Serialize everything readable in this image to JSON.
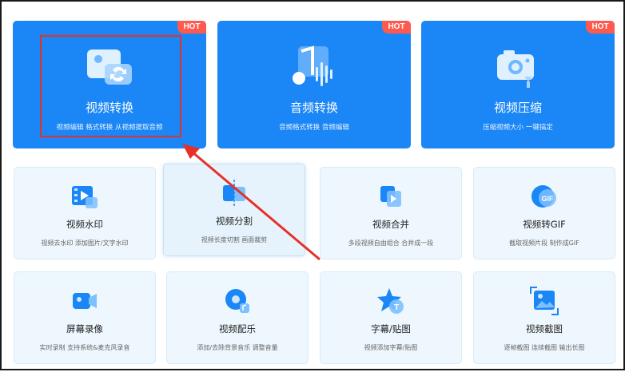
{
  "top_cards": [
    {
      "badge": "HOT",
      "title": "视频转换",
      "desc": "视频编辑 格式转换 从视频提取音频",
      "icon": "video-convert-icon"
    },
    {
      "badge": "HOT",
      "title": "音频转换",
      "desc": "音频格式转换 音频编辑",
      "icon": "audio-convert-icon"
    },
    {
      "badge": "HOT",
      "title": "视频压缩",
      "desc": "压缩视频大小 一键搞定",
      "icon": "video-compress-icon"
    }
  ],
  "tools_row1": [
    {
      "title": "视频水印",
      "desc": "视频去水印 添加图片/文字水印",
      "icon": "video-watermark-icon"
    },
    {
      "title": "视频分割",
      "desc": "视频长度切割 画面裁剪",
      "icon": "video-split-icon"
    },
    {
      "title": "视频合并",
      "desc": "多段视频自由组合 合并成一段",
      "icon": "video-merge-icon"
    },
    {
      "title": "视频转GIF",
      "desc": "截取视频片段 制作成GIF",
      "icon": "gif-icon",
      "icon_text": "GIF"
    }
  ],
  "tools_row2": [
    {
      "title": "屏幕录像",
      "desc": "实时录制 支持系统&麦克风录音",
      "icon": "screen-record-icon"
    },
    {
      "title": "视频配乐",
      "desc": "添加/去除背景音乐 调整音量",
      "icon": "video-music-icon"
    },
    {
      "title": "字幕/贴图",
      "desc": "视频添加字幕/贴图",
      "icon": "subtitle-sticker-icon",
      "icon_text": "T"
    },
    {
      "title": "视频截图",
      "desc": "逐帧截图 连续截图 输出长图",
      "icon": "video-screenshot-icon"
    }
  ],
  "colors": {
    "primary": "#1b86f6",
    "hot": "#ff5a4f",
    "annotation": "#e5312a",
    "card_bg": "#eef7fd"
  }
}
